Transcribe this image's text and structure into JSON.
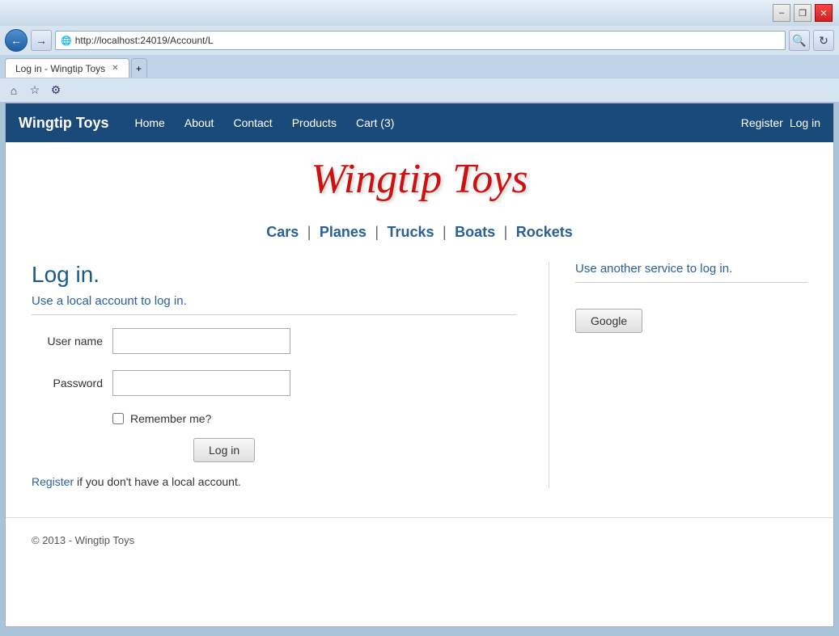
{
  "browser": {
    "title_bar": {
      "minimize_label": "–",
      "restore_label": "❐",
      "close_label": "✕"
    },
    "address_bar": {
      "url": "http://localhost:24019/Account/L",
      "url_icon": "🌐"
    },
    "tab": {
      "label": "Log in - Wingtip Toys",
      "close": "✕"
    },
    "toolbar": {
      "home_icon": "⌂",
      "star_icon": "☆",
      "gear_icon": "⚙"
    }
  },
  "site": {
    "brand": "Wingtip Toys",
    "title_display": "Wingtip Toys",
    "nav": {
      "home": "Home",
      "about": "About",
      "contact": "Contact",
      "products": "Products",
      "cart": "Cart (3)",
      "register": "Register",
      "login": "Log in"
    },
    "categories": [
      {
        "label": "Cars"
      },
      {
        "label": "Planes"
      },
      {
        "label": "Trucks"
      },
      {
        "label": "Boats"
      },
      {
        "label": "Rockets"
      }
    ],
    "login_page": {
      "heading": "Log in.",
      "local_subtitle": "Use a local account to log in.",
      "service_subtitle": "Use another service to log in.",
      "username_label": "User name",
      "password_label": "Password",
      "remember_label": "Remember me?",
      "login_button": "Log in",
      "register_text": " if you don't have a local account.",
      "register_link": "Register",
      "google_button": "Google"
    },
    "footer": {
      "copyright": "© 2013 - Wingtip Toys"
    }
  }
}
